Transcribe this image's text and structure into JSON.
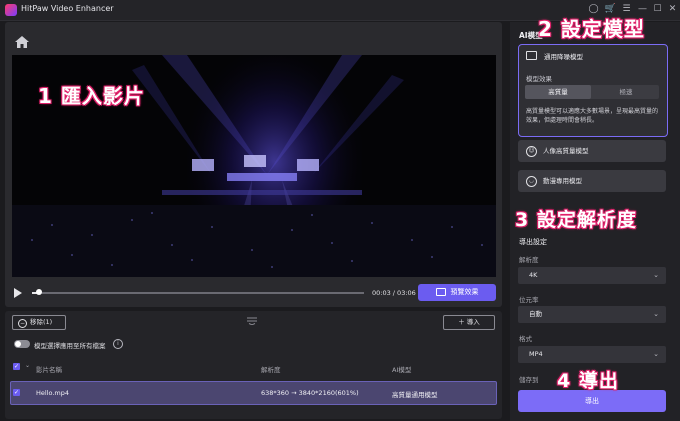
{
  "window": {
    "title": "HitPaw Video Enhancer",
    "icons": [
      "account-icon",
      "cart-icon",
      "menu-icon",
      "minimize-icon",
      "maximize-icon",
      "close-icon"
    ]
  },
  "player": {
    "time": "00:03 / 03:06",
    "preview_label": "預覽效果",
    "progress": 0.02
  },
  "list": {
    "remove_label": "移除(1)",
    "import_label": "導入",
    "apply_all_label": "模型選擇應用至所有檔案",
    "columns": {
      "name": "影片名稱",
      "resolution": "解析度",
      "model": "AI模型"
    },
    "rows": [
      {
        "name": "Hello.mp4",
        "resolution": "638*360 → 3840*2160(601%)",
        "model": "高質量通用模型"
      }
    ]
  },
  "right": {
    "ai_title": "AI模型",
    "general_model": {
      "title": "通用降噪模型",
      "effect_label": "模型效果",
      "options": [
        "高質量",
        "極速"
      ],
      "selected": "高質量",
      "description": "高質量模型可以適應大多數場景，呈現最高質量的效果，但處理時間會稍長。"
    },
    "models": [
      {
        "label": "人像高質量模型",
        "icon": "portrait-icon"
      },
      {
        "label": "動漫專用模型",
        "icon": "anime-icon"
      }
    ],
    "export": {
      "title": "導出設定",
      "resolution_label": "解析度",
      "resolution_value": "4K",
      "bitrate_label": "位元率",
      "bitrate_value": "自動",
      "format_label": "格式",
      "format_value": "MP4",
      "save_label": "儲存到",
      "export_label": "導出"
    }
  },
  "annotations": {
    "a1": "1  匯入影片",
    "a2": "2  設定模型",
    "a3": "3  設定解析度",
    "a4": "4  導出"
  },
  "colors": {
    "accent": "#7c6cf7",
    "annotation": "#e0206a",
    "background": "#1b1b1e"
  }
}
